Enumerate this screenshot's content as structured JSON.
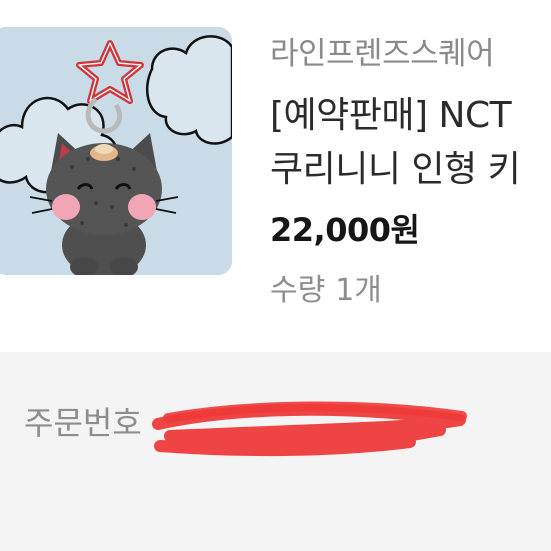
{
  "product": {
    "store_name": "라인프렌즈스퀘어",
    "title_line1": "[예약판매] NCT",
    "title_line2": "쿠리니니 인형 키",
    "price": "22,000원",
    "quantity_label": "수량",
    "quantity_value": "1개",
    "thumbnail_icon": "plush-keyring-photo"
  },
  "order": {
    "order_number_label": "주문번호"
  },
  "colors": {
    "redaction": "#ee3a3a",
    "thumb_background": "#c9dbe8"
  }
}
